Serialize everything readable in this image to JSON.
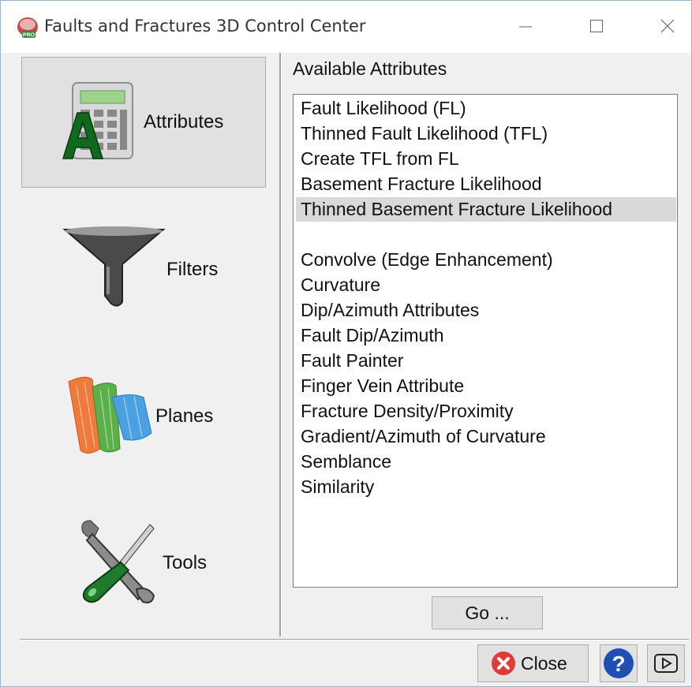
{
  "window": {
    "title": "Faults and Fractures 3D Control Center",
    "app_icon_badge": "PRO"
  },
  "nav": {
    "items": [
      {
        "label": "Attributes",
        "icon": "calculator-icon",
        "selected": true
      },
      {
        "label": "Filters",
        "icon": "funnel-icon",
        "selected": false
      },
      {
        "label": "Planes",
        "icon": "planes-icon",
        "selected": false
      },
      {
        "label": "Tools",
        "icon": "tools-icon",
        "selected": false
      }
    ]
  },
  "attributes": {
    "header": "Available Attributes",
    "items": [
      "Fault Likelihood (FL)",
      "Thinned Fault Likelihood (TFL)",
      "Create TFL from FL",
      "Basement Fracture Likelihood",
      "Thinned Basement Fracture Likelihood",
      "",
      "Convolve (Edge Enhancement)",
      "Curvature",
      "Dip/Azimuth Attributes",
      "Fault Dip/Azimuth",
      "Fault Painter",
      "Finger Vein Attribute",
      "Fracture Density/Proximity",
      "Gradient/Azimuth of Curvature",
      "Semblance",
      "Similarity"
    ],
    "selected_index": 4
  },
  "buttons": {
    "go": "Go ...",
    "close": "Close",
    "help": "?"
  },
  "colors": {
    "selection": "#d9d9d9",
    "nav_selected": "#e1e1e1",
    "close_icon": "#e03a3a",
    "help_icon": "#1f4fb5"
  }
}
